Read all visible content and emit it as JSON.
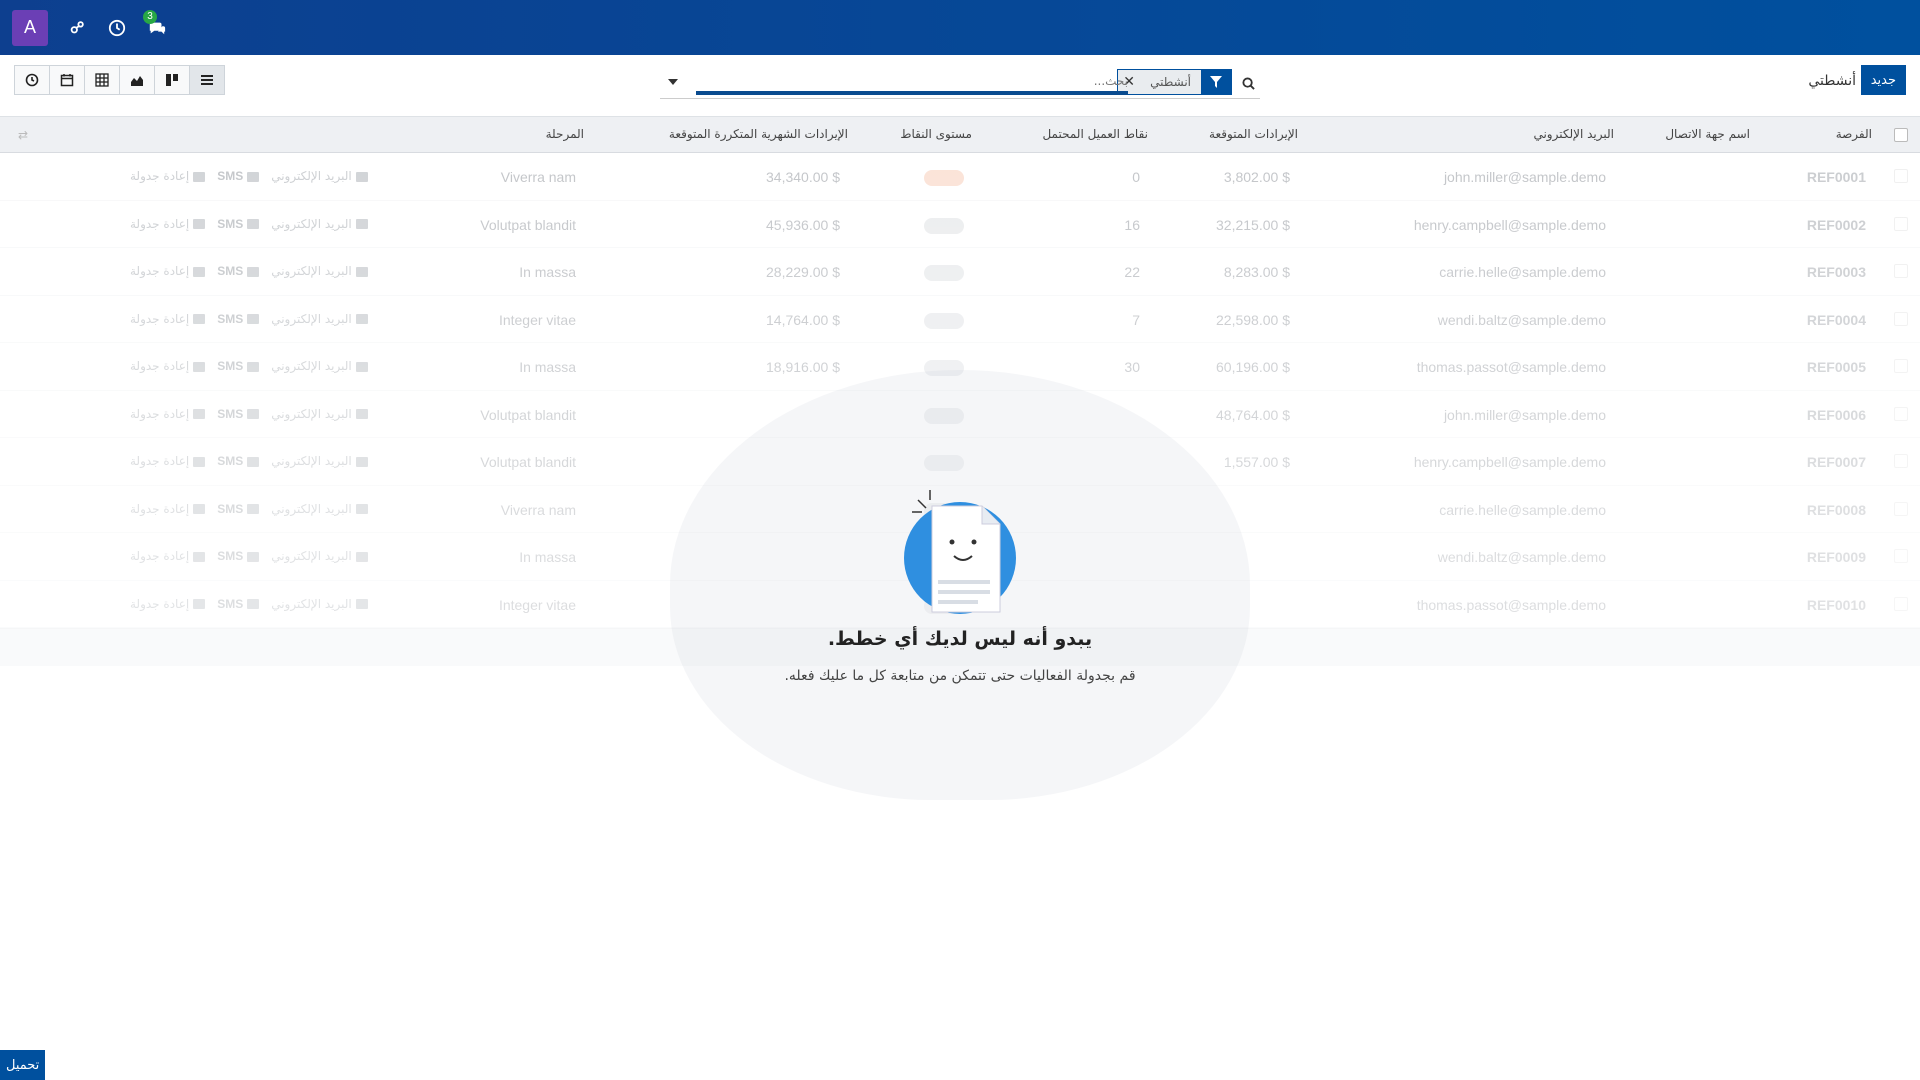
{
  "navbar": {
    "user_initial": "A",
    "chat_badge": "3"
  },
  "control": {
    "new_button": "جديد",
    "breadcrumb": "أنشطتي",
    "facet_label": "أنشطتي",
    "facet_remove": "✕",
    "search_placeholder": "بحث..."
  },
  "table": {
    "headers": {
      "opportunity": "الفرصة",
      "contact": "اسم جهة الاتصال",
      "email": "البريد الإلكتروني",
      "revenue": "الإيرادات المتوقعة",
      "prob": "نقاط العميل المحتمل",
      "priority": "مستوى النقاط",
      "mrr": "الإيرادات الشهرية المتكررة المتوقعة",
      "stage": "المرحلة"
    },
    "action_email": "البريد الإلكتروني",
    "action_sms": "SMS",
    "action_reschedule": "إعادة جدولة",
    "rows": [
      {
        "ref": "REF0001",
        "email": "john.miller@sample.demo",
        "revenue": "$ 3,802.00",
        "prob": "0",
        "mrr": "$ 34,340.00",
        "stage": "Viverra nam"
      },
      {
        "ref": "REF0002",
        "email": "henry.campbell@sample.demo",
        "revenue": "$ 32,215.00",
        "prob": "16",
        "mrr": "$ 45,936.00",
        "stage": "Volutpat blandit"
      },
      {
        "ref": "REF0003",
        "email": "carrie.helle@sample.demo",
        "revenue": "$ 8,283.00",
        "prob": "22",
        "mrr": "$ 28,229.00",
        "stage": "In massa"
      },
      {
        "ref": "REF0004",
        "email": "wendi.baltz@sample.demo",
        "revenue": "$ 22,598.00",
        "prob": "7",
        "mrr": "$ 14,764.00",
        "stage": "Integer vitae"
      },
      {
        "ref": "REF0005",
        "email": "thomas.passot@sample.demo",
        "revenue": "$ 60,196.00",
        "prob": "30",
        "mrr": "$ 18,916.00",
        "stage": "In massa"
      },
      {
        "ref": "REF0006",
        "email": "john.miller@sample.demo",
        "revenue": "$ 48,764.00",
        "prob": "",
        "mrr": "",
        "stage": "Volutpat blandit"
      },
      {
        "ref": "REF0007",
        "email": "henry.campbell@sample.demo",
        "revenue": "$ 1,557.00",
        "prob": "",
        "mrr": "",
        "stage": "Volutpat blandit"
      },
      {
        "ref": "REF0008",
        "email": "carrie.helle@sample.demo",
        "revenue": "",
        "prob": "",
        "mrr": "",
        "stage": "Viverra nam"
      },
      {
        "ref": "REF0009",
        "email": "wendi.baltz@sample.demo",
        "revenue": "",
        "prob": "",
        "mrr": "",
        "stage": "In massa"
      },
      {
        "ref": "REF0010",
        "email": "thomas.passot@sample.demo",
        "revenue": "",
        "prob": "",
        "mrr": "",
        "stage": "Integer vitae"
      }
    ]
  },
  "helper": {
    "title": "يبدو أنه ليس لديك أي خطط.",
    "subtitle": "قم بجدولة الفعاليات حتى تتمكن من متابعة كل ما عليك فعله."
  },
  "download_label": "تحميل"
}
